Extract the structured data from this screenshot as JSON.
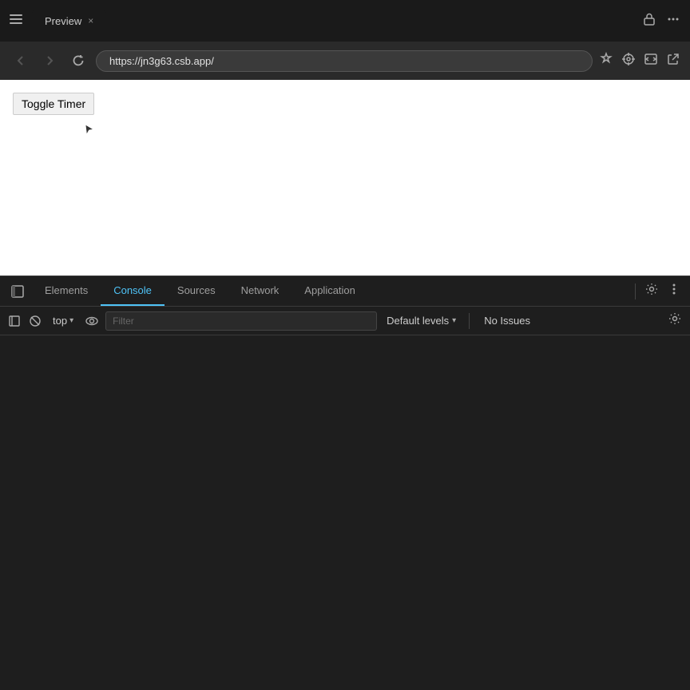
{
  "titlebar": {
    "menu_icon": "≡",
    "tab_title": "Preview",
    "tab_close": "×",
    "lock_icon": "🔒",
    "more_icon": "⋯"
  },
  "navbar": {
    "back_title": "Back",
    "forward_title": "Forward",
    "reload_title": "Reload",
    "url": "https://jn3g63.csb.app/",
    "pin_icon": "📌",
    "target_icon": "⊕",
    "code_icon": "▷",
    "external_icon": "⬡"
  },
  "page": {
    "toggle_button_label": "Toggle Timer"
  },
  "devtools": {
    "toolbar_icon": "⊞",
    "tabs": [
      {
        "id": "elements",
        "label": "Elements",
        "active": false
      },
      {
        "id": "console",
        "label": "Console",
        "active": true
      },
      {
        "id": "sources",
        "label": "Sources",
        "active": false
      },
      {
        "id": "network",
        "label": "Network",
        "active": false
      },
      {
        "id": "application",
        "label": "Application",
        "active": false
      }
    ],
    "settings_icon": "⚙",
    "more_icon": "⋮"
  },
  "console_toolbar": {
    "sidebar_icon": "▣",
    "clear_icon": "⊘",
    "context_label": "top",
    "context_arrow": "▾",
    "eye_icon": "👁",
    "filter_placeholder": "Filter",
    "default_levels_label": "Default levels",
    "default_levels_arrow": "▾",
    "no_issues_label": "No Issues",
    "settings_icon": "⚙"
  }
}
